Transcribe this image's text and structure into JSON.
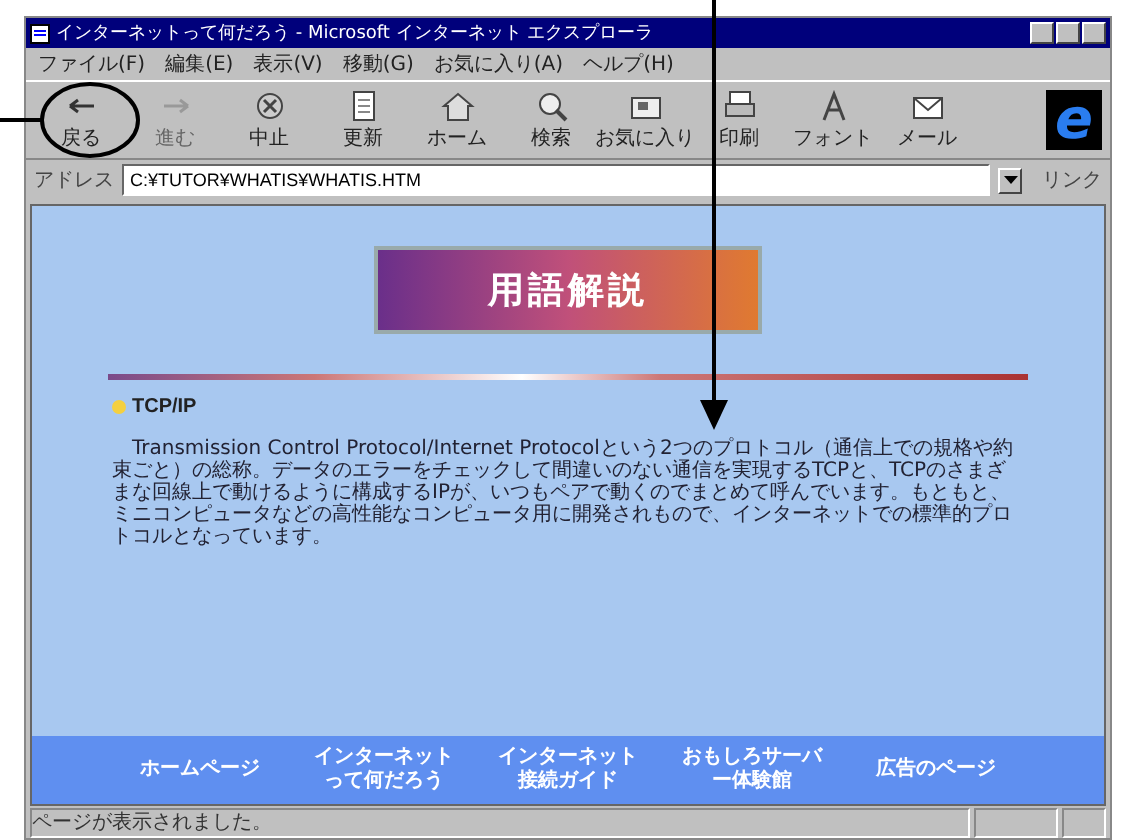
{
  "window": {
    "title": "インターネットって何だろう - Microsoft インターネット エクスプローラ"
  },
  "menu": [
    "ファイル(F)",
    "編集(E)",
    "表示(V)",
    "移動(G)",
    "お気に入り(A)",
    "ヘルプ(H)"
  ],
  "toolbar": [
    {
      "label": "戻る",
      "disabled": false
    },
    {
      "label": "進む",
      "disabled": true
    },
    {
      "label": "中止",
      "disabled": false
    },
    {
      "label": "更新",
      "disabled": false
    },
    {
      "label": "ホーム",
      "disabled": false
    },
    {
      "label": "検索",
      "disabled": false
    },
    {
      "label": "お気に入り",
      "disabled": false
    },
    {
      "label": "印刷",
      "disabled": false
    },
    {
      "label": "フォント",
      "disabled": false
    },
    {
      "label": "メール",
      "disabled": false
    }
  ],
  "logo": "e",
  "address": {
    "label": "アドレス",
    "value": "C:¥TUTOR¥WHATIS¥WHATIS.HTM",
    "links": "リンク"
  },
  "page": {
    "banner": "用語解説",
    "term": "TCP/IP",
    "text": "Transmission Control Protocol/Internet Protocolという2つのプロトコル（通信上での規格や約束ごと）の総称。データのエラーをチェックして間違いのない通信を実現するTCPと、TCPのさまざまな回線上で動けるように構成するIPが、いつもペアで動くのでまとめて呼んでいます。もともと、ミニコンピュータなどの高性能なコンピュータ用に開発されもので、インターネットでの標準的プロトコルとなっています。"
  },
  "nav": [
    "ホームページ",
    "インターネットって何だろう",
    "インターネット接続ガイド",
    "おもしろサーバー体験館",
    "広告のページ"
  ],
  "status_bar": "ページが表示されました。"
}
